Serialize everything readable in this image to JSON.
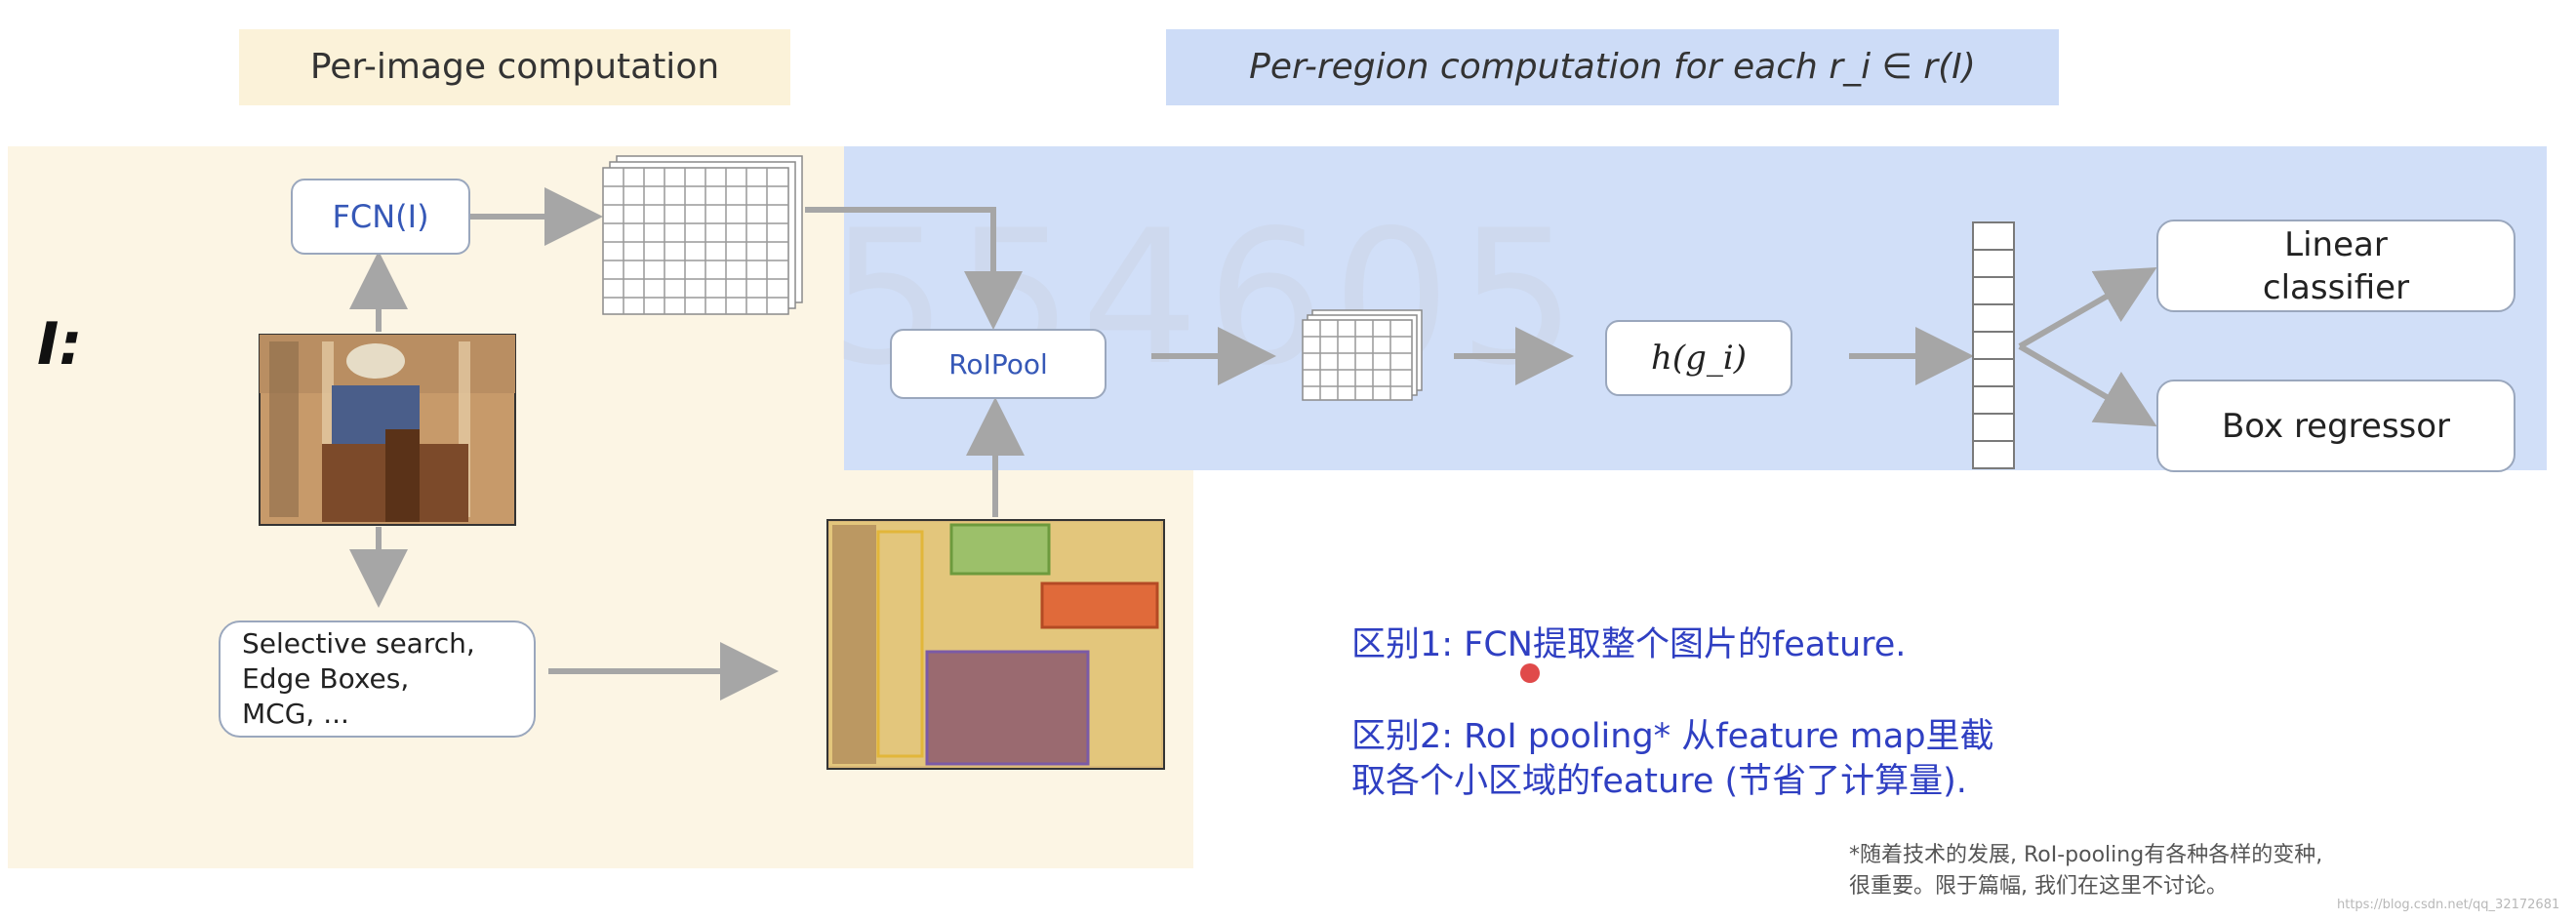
{
  "headers": {
    "per_image": "Per-image computation",
    "per_region": "Per-region computation for each r_i ∈ r(I)"
  },
  "watermark": "554605",
  "input_label": "I:",
  "nodes": {
    "fcn": "FCN(I)",
    "roipool": "RoIPool",
    "h": "h(g_i)",
    "proposals": [
      "Selective search,",
      "Edge Boxes,",
      "MCG, ..."
    ],
    "linear_classifier": [
      "Linear",
      "classifier"
    ],
    "box_regressor": "Box regressor"
  },
  "notes": {
    "diff1": "区别1: FCN提取整个图片的feature.",
    "diff2_line1": "区别2: RoI pooling* 从feature map里截",
    "diff2_line2": "取各个小区域的feature (节省了计算量)."
  },
  "footnote": {
    "line1": "*随着技术的发展, RoI-pooling有各种各样的变种,",
    "line2": "很重要。限于篇幅, 我们在这里不讨论。"
  },
  "url_watermark": "https://blog.csdn.net/qq_32172681",
  "colors": {
    "panel_yellow": "#fcf5e4",
    "panel_blue": "#d1dff8",
    "arrow": "#a6a6a6",
    "note_blue": "#2f3fc2",
    "red_dot": "#e04a4a"
  }
}
